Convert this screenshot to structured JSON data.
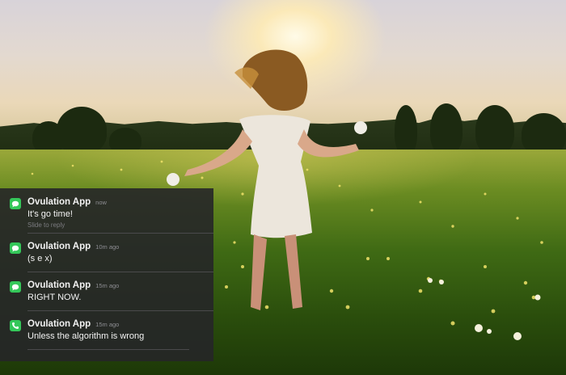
{
  "notifications": [
    {
      "app": "Ovulation App",
      "time": "now",
      "message": "It's go time!",
      "hint": "Slide to reply",
      "icon": "message-bubble-icon"
    },
    {
      "app": "Ovulation App",
      "time": "10m ago",
      "message": "(s e x)",
      "icon": "message-bubble-icon"
    },
    {
      "app": "Ovulation App",
      "time": "15m ago",
      "message": "RIGHT NOW.",
      "icon": "message-bubble-icon"
    },
    {
      "app": "Ovulation App",
      "time": "15m ago",
      "message": "Unless the algorithm is wrong",
      "icon": "phone-icon"
    }
  ],
  "colors": {
    "panel_background": "#262628",
    "app_icon_green": "#34c759",
    "text_primary": "#f2f2f2",
    "text_secondary": "#8e8e93"
  }
}
